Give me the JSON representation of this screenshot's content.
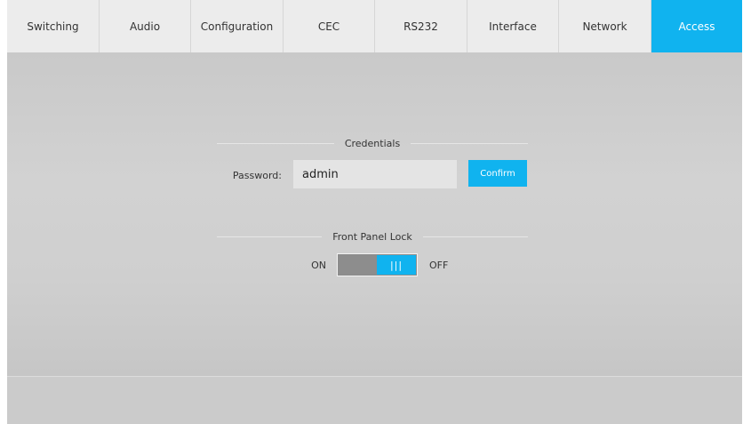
{
  "tabs": [
    {
      "label": "Switching",
      "active": false
    },
    {
      "label": "Audio",
      "active": false
    },
    {
      "label": "Configuration",
      "active": false
    },
    {
      "label": "CEC",
      "active": false
    },
    {
      "label": "RS232",
      "active": false
    },
    {
      "label": "Interface",
      "active": false
    },
    {
      "label": "Network",
      "active": false
    },
    {
      "label": "Access",
      "active": true
    }
  ],
  "credentials": {
    "title": "Credentials",
    "password_label": "Password:",
    "password_value": "admin",
    "confirm_label": "Confirm"
  },
  "front_panel_lock": {
    "title": "Front Panel Lock",
    "on_label": "ON",
    "off_label": "OFF",
    "knob_glyph": "|||",
    "state": "OFF"
  },
  "colors": {
    "accent": "#10b3ef",
    "tab_bg": "#ececec",
    "panel_bg": "#cfcfcf"
  }
}
